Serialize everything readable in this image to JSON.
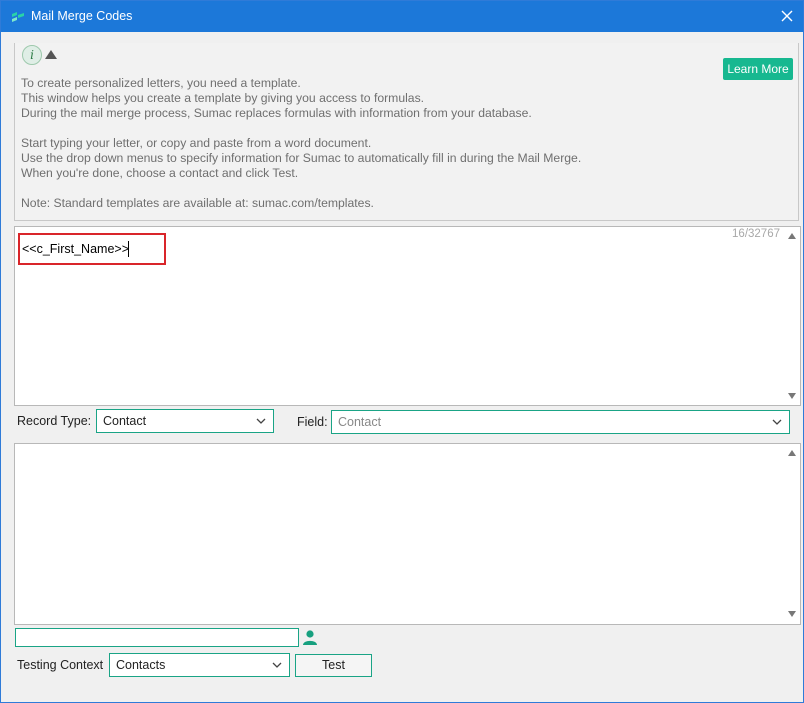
{
  "window": {
    "title": "Mail Merge Codes",
    "icons": {
      "app": "sumac-logo-icon",
      "close": "close-icon"
    }
  },
  "info_panel": {
    "icon": "info-icon",
    "collapse_icon": "collapse-triangle-icon",
    "learn_more_label": "Learn More",
    "lines": [
      "To create personalized letters, you need a template.",
      "This window helps you create a template by giving you access to formulas.",
      "During the mail merge process, Sumac replaces formulas with information from your database.",
      "",
      "Start typing your letter, or copy and paste from a word document.",
      "Use the drop down menus to specify information for Sumac to automatically fill in during the Mail Merge.",
      "When you're done, choose a contact and click Test.",
      "",
      "Note: Standard templates are available at: sumac.com/templates."
    ]
  },
  "editor": {
    "char_count": "16/32767",
    "content": "<<c_First_Name>>"
  },
  "record_type": {
    "label": "Record Type:",
    "value": "Contact"
  },
  "field": {
    "label": "Field:",
    "value": "Contact"
  },
  "preview": {
    "content": ""
  },
  "contact_search": {
    "value": ""
  },
  "testing_context": {
    "label": "Testing Context",
    "value": "Contacts"
  },
  "test_button": {
    "label": "Test"
  },
  "colors": {
    "titlebar": "#1c78d9",
    "accent": "#17b890",
    "highlight_border": "#d9252a"
  }
}
